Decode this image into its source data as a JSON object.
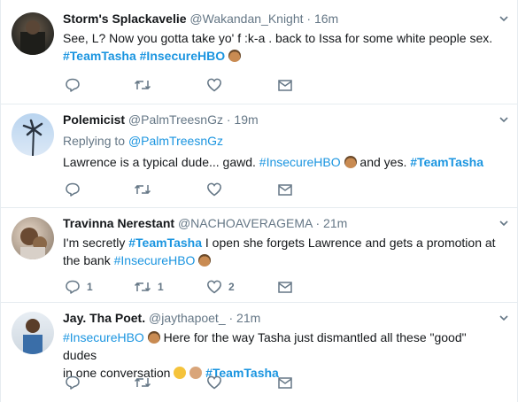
{
  "tweets": [
    {
      "name": "Storm's Splackavelie",
      "handle": "@Wakandan_Knight",
      "time": "· 16m",
      "line1": "See, L? Now you gotta take yo' f    :k-a    . back to Issa for some white people sex.",
      "tag1": "#TeamTasha",
      "tag2": "#InsecureHBO",
      "emoji": "man-emoji"
    },
    {
      "name": "Polemicist",
      "handle": "@PalmTreesnGz",
      "time": "· 19m",
      "replying_label": "Replying to",
      "replying_handle": "@PalmTreesnGz",
      "text_pre": "Lawrence is a typical dude... gawd.",
      "tag1": "#InsecureHBO",
      "text_mid": "and yes.",
      "tag2": "#TeamTasha"
    },
    {
      "name": "Travinna Nerestant",
      "handle": "@NACHOAVERAGEMA",
      "time": "· 21m",
      "text_pre": "I'm secretly",
      "tag1": "#TeamTasha",
      "text_mid": "I open she forgets Lawrence and gets a promotion at",
      "text_line2": "the bank",
      "tag2": "#InsecureHBO",
      "reply_count": "1",
      "retweet_count": "1",
      "like_count": "2"
    },
    {
      "name": "Jay. Tha Poet.",
      "handle": "@jaythapoet_",
      "time": "· 21m",
      "tag1": "#InsecureHBO",
      "text_mid": "Here for the way Tasha just dismantled all these \"good\" dudes",
      "text_line2": "in one conversation",
      "tag2": "#TeamTasha"
    }
  ],
  "colors": {
    "accent": "#1b95e0",
    "muted": "#657786",
    "divider": "#e6ecf0"
  }
}
